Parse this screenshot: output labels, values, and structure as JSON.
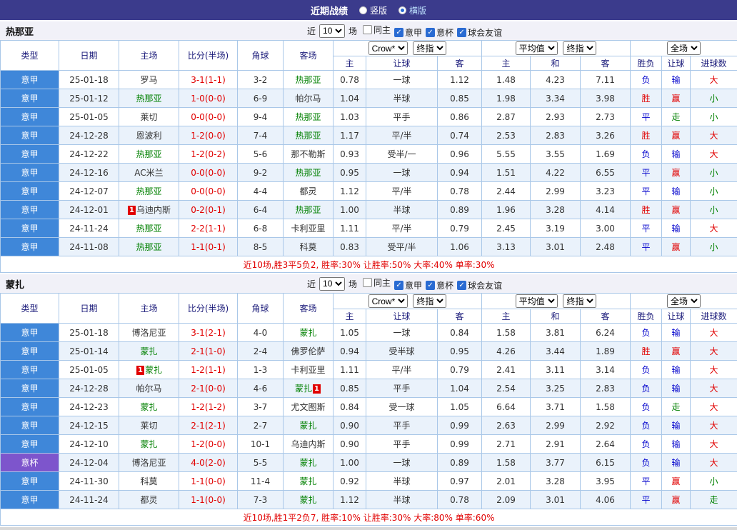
{
  "topbar": {
    "title": "近期战绩",
    "radios": [
      {
        "label": "竖版",
        "selected": false
      },
      {
        "label": "横版",
        "selected": true
      }
    ]
  },
  "filter": {
    "near_label": "近",
    "count": "10",
    "matches_label": "场",
    "checkboxes": [
      {
        "label": "同主",
        "checked": false
      },
      {
        "label": "意甲",
        "checked": true
      },
      {
        "label": "意杯",
        "checked": true
      },
      {
        "label": "球会友谊",
        "checked": true
      }
    ]
  },
  "header": {
    "type": "类型",
    "date": "日期",
    "home": "主场",
    "score": "比分(半场)",
    "corner": "角球",
    "away": "客场",
    "asia_company": "Crow*",
    "asia_stage": "终指",
    "euro_company": "平均值",
    "euro_stage": "终指",
    "scope": "全场",
    "asia_cols": [
      "主",
      "让球",
      "客"
    ],
    "euro_cols": [
      "主",
      "和",
      "客"
    ],
    "result_cols": [
      "胜负",
      "让球",
      "进球数"
    ]
  },
  "colors": {
    "topbar_bg": "#3B3B8C",
    "league_bg": "#3F87D9",
    "cup_bg": "#7D55CC",
    "grid": "#A9C7E8",
    "row_alt": "#EAF2FB",
    "strip_bg": "#F1F1F8",
    "red": "#E10000",
    "green": "#008000",
    "blue": "#0000CC",
    "check_blue": "#2A6BD2"
  },
  "sections": [
    {
      "team": "热那亚",
      "rows": [
        {
          "league": "意甲",
          "cup": false,
          "date": "25-01-18",
          "home": {
            "name": "罗马"
          },
          "score": "3-1(1-1)",
          "corner": "3-2",
          "away": {
            "name": "热那亚",
            "highlight": true
          },
          "asia": [
            "0.78",
            "一球",
            "1.12"
          ],
          "euro": [
            "1.48",
            "4.23",
            "7.11"
          ],
          "result": [
            [
              "负",
              "blue"
            ],
            [
              "输",
              "blue"
            ],
            [
              "大",
              "red"
            ]
          ]
        },
        {
          "league": "意甲",
          "cup": false,
          "date": "25-01-12",
          "home": {
            "name": "热那亚",
            "highlight": true
          },
          "score": "1-0(0-0)",
          "corner": "6-9",
          "away": {
            "name": "帕尔马"
          },
          "asia": [
            "1.04",
            "半球",
            "0.85"
          ],
          "euro": [
            "1.98",
            "3.34",
            "3.98"
          ],
          "result": [
            [
              "胜",
              "red"
            ],
            [
              "赢",
              "red"
            ],
            [
              "小",
              "green"
            ]
          ]
        },
        {
          "league": "意甲",
          "cup": false,
          "date": "25-01-05",
          "home": {
            "name": "莱切"
          },
          "score": "0-0(0-0)",
          "corner": "9-4",
          "away": {
            "name": "热那亚",
            "highlight": true
          },
          "asia": [
            "1.03",
            "平手",
            "0.86"
          ],
          "euro": [
            "2.87",
            "2.93",
            "2.73"
          ],
          "result": [
            [
              "平",
              "blue"
            ],
            [
              "走",
              "green"
            ],
            [
              "小",
              "green"
            ]
          ]
        },
        {
          "league": "意甲",
          "cup": false,
          "date": "24-12-28",
          "home": {
            "name": "恩波利"
          },
          "score": "1-2(0-0)",
          "corner": "7-4",
          "away": {
            "name": "热那亚",
            "highlight": true
          },
          "asia": [
            "1.17",
            "平/半",
            "0.74"
          ],
          "euro": [
            "2.53",
            "2.83",
            "3.26"
          ],
          "result": [
            [
              "胜",
              "red"
            ],
            [
              "赢",
              "red"
            ],
            [
              "大",
              "red"
            ]
          ]
        },
        {
          "league": "意甲",
          "cup": false,
          "date": "24-12-22",
          "home": {
            "name": "热那亚",
            "highlight": true
          },
          "score": "1-2(0-2)",
          "corner": "5-6",
          "away": {
            "name": "那不勒斯"
          },
          "asia": [
            "0.93",
            "受半/一",
            "0.96"
          ],
          "euro": [
            "5.55",
            "3.55",
            "1.69"
          ],
          "result": [
            [
              "负",
              "blue"
            ],
            [
              "输",
              "blue"
            ],
            [
              "大",
              "red"
            ]
          ]
        },
        {
          "league": "意甲",
          "cup": false,
          "date": "24-12-16",
          "home": {
            "name": "AC米兰"
          },
          "score": "0-0(0-0)",
          "corner": "9-2",
          "away": {
            "name": "热那亚",
            "highlight": true
          },
          "asia": [
            "0.95",
            "一球",
            "0.94"
          ],
          "euro": [
            "1.51",
            "4.22",
            "6.55"
          ],
          "result": [
            [
              "平",
              "blue"
            ],
            [
              "赢",
              "red"
            ],
            [
              "小",
              "green"
            ]
          ]
        },
        {
          "league": "意甲",
          "cup": false,
          "date": "24-12-07",
          "home": {
            "name": "热那亚",
            "highlight": true
          },
          "score": "0-0(0-0)",
          "corner": "4-4",
          "away": {
            "name": "都灵"
          },
          "asia": [
            "1.12",
            "平/半",
            "0.78"
          ],
          "euro": [
            "2.44",
            "2.99",
            "3.23"
          ],
          "result": [
            [
              "平",
              "blue"
            ],
            [
              "输",
              "blue"
            ],
            [
              "小",
              "green"
            ]
          ]
        },
        {
          "league": "意甲",
          "cup": false,
          "date": "24-12-01",
          "home": {
            "name": "乌迪内斯",
            "badge": "1",
            "badge_pos": "before"
          },
          "score": "0-2(0-1)",
          "corner": "6-4",
          "away": {
            "name": "热那亚",
            "highlight": true
          },
          "asia": [
            "1.00",
            "半球",
            "0.89"
          ],
          "euro": [
            "1.96",
            "3.28",
            "4.14"
          ],
          "result": [
            [
              "胜",
              "red"
            ],
            [
              "赢",
              "red"
            ],
            [
              "小",
              "green"
            ]
          ]
        },
        {
          "league": "意甲",
          "cup": false,
          "date": "24-11-24",
          "home": {
            "name": "热那亚",
            "highlight": true
          },
          "score": "2-2(1-1)",
          "corner": "6-8",
          "away": {
            "name": "卡利亚里"
          },
          "asia": [
            "1.11",
            "平/半",
            "0.79"
          ],
          "euro": [
            "2.45",
            "3.19",
            "3.00"
          ],
          "result": [
            [
              "平",
              "blue"
            ],
            [
              "输",
              "blue"
            ],
            [
              "大",
              "red"
            ]
          ]
        },
        {
          "league": "意甲",
          "cup": false,
          "date": "24-11-08",
          "home": {
            "name": "热那亚",
            "highlight": true
          },
          "score": "1-1(0-1)",
          "corner": "8-5",
          "away": {
            "name": "科莫"
          },
          "asia": [
            "0.83",
            "受平/半",
            "1.06"
          ],
          "euro": [
            "3.13",
            "3.01",
            "2.48"
          ],
          "result": [
            [
              "平",
              "blue"
            ],
            [
              "赢",
              "red"
            ],
            [
              "小",
              "green"
            ]
          ]
        }
      ],
      "summary": "近10场,胜3平5负2, 胜率:30% 让胜率:50% 大率:40% 单率:30%"
    },
    {
      "team": "蒙扎",
      "rows": [
        {
          "league": "意甲",
          "cup": false,
          "date": "25-01-18",
          "home": {
            "name": "博洛尼亚"
          },
          "score": "3-1(2-1)",
          "corner": "4-0",
          "away": {
            "name": "蒙扎",
            "highlight": true
          },
          "asia": [
            "1.05",
            "一球",
            "0.84"
          ],
          "euro": [
            "1.58",
            "3.81",
            "6.24"
          ],
          "result": [
            [
              "负",
              "blue"
            ],
            [
              "输",
              "blue"
            ],
            [
              "大",
              "red"
            ]
          ]
        },
        {
          "league": "意甲",
          "cup": false,
          "date": "25-01-14",
          "home": {
            "name": "蒙扎",
            "highlight": true
          },
          "score": "2-1(1-0)",
          "corner": "2-4",
          "away": {
            "name": "佛罗伦萨"
          },
          "asia": [
            "0.94",
            "受半球",
            "0.95"
          ],
          "euro": [
            "4.26",
            "3.44",
            "1.89"
          ],
          "result": [
            [
              "胜",
              "red"
            ],
            [
              "赢",
              "red"
            ],
            [
              "大",
              "red"
            ]
          ]
        },
        {
          "league": "意甲",
          "cup": false,
          "date": "25-01-05",
          "home": {
            "name": "蒙扎",
            "highlight": true,
            "badge": "1",
            "badge_pos": "before"
          },
          "score": "1-2(1-1)",
          "corner": "1-3",
          "away": {
            "name": "卡利亚里"
          },
          "asia": [
            "1.11",
            "平/半",
            "0.79"
          ],
          "euro": [
            "2.41",
            "3.11",
            "3.14"
          ],
          "result": [
            [
              "负",
              "blue"
            ],
            [
              "输",
              "blue"
            ],
            [
              "大",
              "red"
            ]
          ]
        },
        {
          "league": "意甲",
          "cup": false,
          "date": "24-12-28",
          "home": {
            "name": "帕尔马"
          },
          "score": "2-1(0-0)",
          "corner": "4-6",
          "away": {
            "name": "蒙扎",
            "highlight": true,
            "badge": "1",
            "badge_pos": "after"
          },
          "asia": [
            "0.85",
            "平手",
            "1.04"
          ],
          "euro": [
            "2.54",
            "3.25",
            "2.83"
          ],
          "result": [
            [
              "负",
              "blue"
            ],
            [
              "输",
              "blue"
            ],
            [
              "大",
              "red"
            ]
          ]
        },
        {
          "league": "意甲",
          "cup": false,
          "date": "24-12-23",
          "home": {
            "name": "蒙扎",
            "highlight": true
          },
          "score": "1-2(1-2)",
          "corner": "3-7",
          "away": {
            "name": "尤文图斯"
          },
          "asia": [
            "0.84",
            "受一球",
            "1.05"
          ],
          "euro": [
            "6.64",
            "3.71",
            "1.58"
          ],
          "result": [
            [
              "负",
              "blue"
            ],
            [
              "走",
              "green"
            ],
            [
              "大",
              "red"
            ]
          ]
        },
        {
          "league": "意甲",
          "cup": false,
          "date": "24-12-15",
          "home": {
            "name": "莱切"
          },
          "score": "2-1(2-1)",
          "corner": "2-7",
          "away": {
            "name": "蒙扎",
            "highlight": true
          },
          "asia": [
            "0.90",
            "平手",
            "0.99"
          ],
          "euro": [
            "2.63",
            "2.99",
            "2.92"
          ],
          "result": [
            [
              "负",
              "blue"
            ],
            [
              "输",
              "blue"
            ],
            [
              "大",
              "red"
            ]
          ]
        },
        {
          "league": "意甲",
          "cup": false,
          "date": "24-12-10",
          "home": {
            "name": "蒙扎",
            "highlight": true
          },
          "score": "1-2(0-0)",
          "corner": "10-1",
          "away": {
            "name": "乌迪内斯"
          },
          "asia": [
            "0.90",
            "平手",
            "0.99"
          ],
          "euro": [
            "2.71",
            "2.91",
            "2.64"
          ],
          "result": [
            [
              "负",
              "blue"
            ],
            [
              "输",
              "blue"
            ],
            [
              "大",
              "red"
            ]
          ]
        },
        {
          "league": "意杯",
          "cup": true,
          "date": "24-12-04",
          "home": {
            "name": "博洛尼亚"
          },
          "score": "4-0(2-0)",
          "corner": "5-5",
          "away": {
            "name": "蒙扎",
            "highlight": true
          },
          "asia": [
            "1.00",
            "一球",
            "0.89"
          ],
          "euro": [
            "1.58",
            "3.77",
            "6.15"
          ],
          "result": [
            [
              "负",
              "blue"
            ],
            [
              "输",
              "blue"
            ],
            [
              "大",
              "red"
            ]
          ]
        },
        {
          "league": "意甲",
          "cup": false,
          "date": "24-11-30",
          "home": {
            "name": "科莫"
          },
          "score": "1-1(0-0)",
          "corner": "11-4",
          "away": {
            "name": "蒙扎",
            "highlight": true
          },
          "asia": [
            "0.92",
            "半球",
            "0.97"
          ],
          "euro": [
            "2.01",
            "3.28",
            "3.95"
          ],
          "result": [
            [
              "平",
              "blue"
            ],
            [
              "赢",
              "red"
            ],
            [
              "小",
              "green"
            ]
          ]
        },
        {
          "league": "意甲",
          "cup": false,
          "date": "24-11-24",
          "home": {
            "name": "都灵"
          },
          "score": "1-1(0-0)",
          "corner": "7-3",
          "away": {
            "name": "蒙扎",
            "highlight": true
          },
          "asia": [
            "1.12",
            "半球",
            "0.78"
          ],
          "euro": [
            "2.09",
            "3.01",
            "4.06"
          ],
          "result": [
            [
              "平",
              "blue"
            ],
            [
              "赢",
              "red"
            ],
            [
              "走",
              "green"
            ]
          ]
        }
      ],
      "summary": "近10场,胜1平2负7, 胜率:10% 让胜率:30% 大率:80% 单率:60%"
    }
  ]
}
